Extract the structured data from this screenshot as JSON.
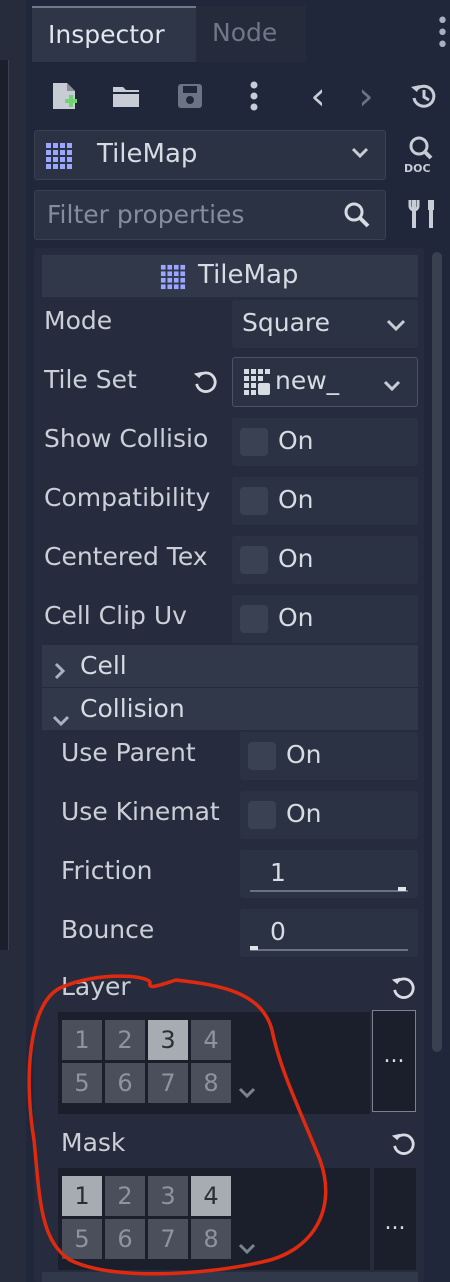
{
  "tabs": {
    "inspector": "Inspector",
    "node": "Node"
  },
  "toolbar": {
    "history_prev": "‹",
    "history_next": "›"
  },
  "object_selector": {
    "value": "TileMap",
    "doc_label": "DOC"
  },
  "filter": {
    "placeholder": "Filter properties"
  },
  "header": {
    "title": "TileMap"
  },
  "properties": [
    {
      "label": "Mode",
      "value": "Square"
    },
    {
      "label": "Tile Set",
      "value": "new_"
    },
    {
      "label": "Show Collisio",
      "value": "On"
    },
    {
      "label": "Compatibility",
      "value": "On"
    },
    {
      "label": "Centered Tex",
      "value": "On"
    },
    {
      "label": "Cell Clip Uv",
      "value": "On"
    }
  ],
  "sections": {
    "cell": "Cell",
    "collision": "Collision"
  },
  "collision": [
    {
      "label": "Use Parent",
      "value": "On"
    },
    {
      "label": "Use Kinemat",
      "value": "On"
    },
    {
      "label": "Friction",
      "value": "1"
    },
    {
      "label": "Bounce",
      "value": "0"
    }
  ],
  "layer": {
    "label": "Layer",
    "bits": [
      "1",
      "2",
      "3",
      "4",
      "5",
      "6",
      "7",
      "8"
    ],
    "selected": [
      3
    ],
    "more": "..."
  },
  "mask": {
    "label": "Mask",
    "bits": [
      "1",
      "2",
      "3",
      "4",
      "5",
      "6",
      "7",
      "8"
    ],
    "selected": [
      1,
      4
    ],
    "more": "..."
  },
  "colors": {
    "annotation": "#e02a10",
    "accent": "#6e7a91"
  }
}
